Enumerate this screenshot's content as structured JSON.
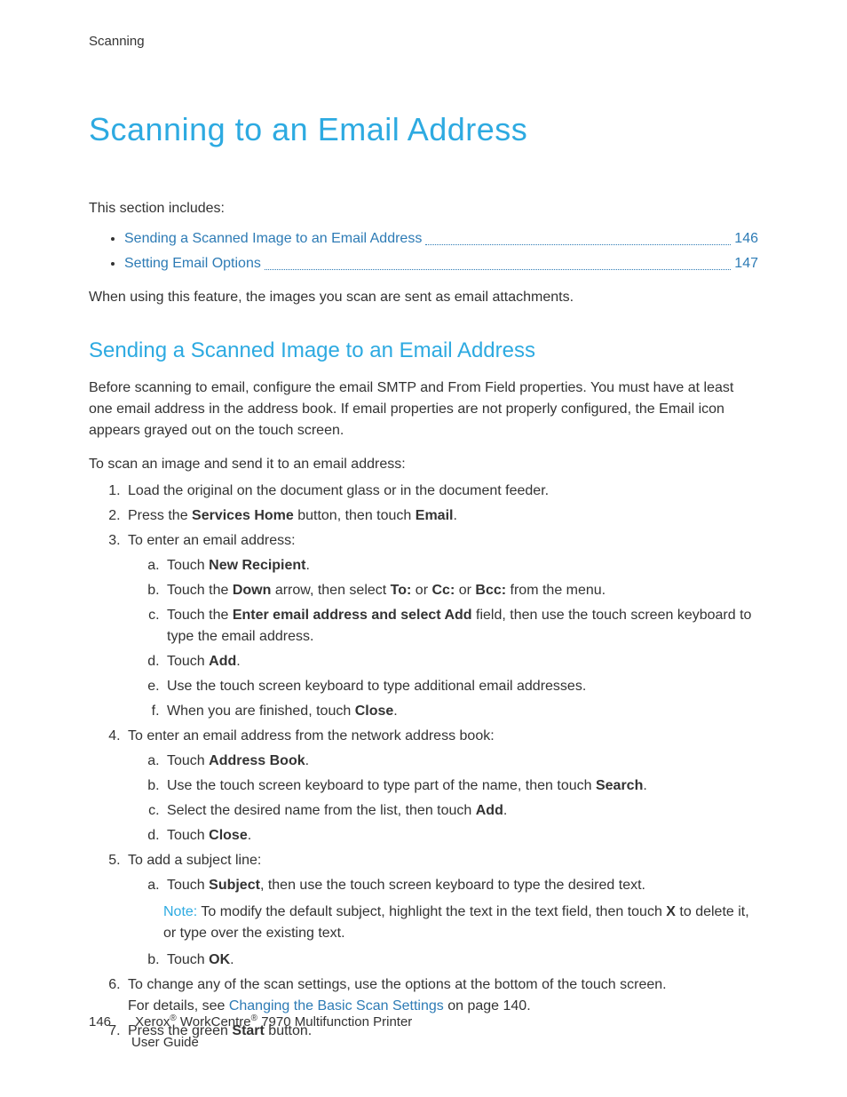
{
  "header": {
    "section_label": "Scanning"
  },
  "title": "Scanning to an Email Address",
  "includes_label": "This section includes:",
  "toc": [
    {
      "label": "Sending a Scanned Image to an Email Address",
      "page": "146"
    },
    {
      "label": "Setting Email Options",
      "page": "147"
    }
  ],
  "intro_para": "When using this feature, the images you scan are sent as email attachments.",
  "section": {
    "title": "Sending a Scanned Image to an Email Address",
    "para1": "Before scanning to email, configure the email SMTP and From Field properties. You must have at least one email address in the address book. If email properties are not properly configured, the Email icon appears grayed out on the touch screen.",
    "para2": "To scan an image and send it to an email address:"
  },
  "steps": {
    "s1": "Load the original on the document glass or in the document feeder.",
    "s2_pre": "Press the ",
    "s2_b1": "Services Home",
    "s2_mid": " button, then touch ",
    "s2_b2": "Email",
    "s2_post": ".",
    "s3": "To enter an email address:",
    "s3a_pre": "Touch ",
    "s3a_b": "New Recipient",
    "s3a_post": ".",
    "s3b_pre": "Touch the ",
    "s3b_b1": "Down",
    "s3b_mid1": " arrow, then select ",
    "s3b_b2": "To:",
    "s3b_mid2": " or ",
    "s3b_b3": "Cc:",
    "s3b_mid3": " or ",
    "s3b_b4": "Bcc:",
    "s3b_post": " from the menu.",
    "s3c_pre": "Touch the ",
    "s3c_b": "Enter email address and select Add",
    "s3c_post": " field, then use the touch screen keyboard to type the email address.",
    "s3d_pre": "Touch ",
    "s3d_b": "Add",
    "s3d_post": ".",
    "s3e": "Use the touch screen keyboard to type additional email addresses.",
    "s3f_pre": "When you are finished, touch ",
    "s3f_b": "Close",
    "s3f_post": ".",
    "s4": "To enter an email address from the network address book:",
    "s4a_pre": "Touch ",
    "s4a_b": "Address Book",
    "s4a_post": ".",
    "s4b_pre": "Use the touch screen keyboard to type part of the name, then touch ",
    "s4b_b": "Search",
    "s4b_post": ".",
    "s4c_pre": "Select the desired name from the list, then touch ",
    "s4c_b": "Add",
    "s4c_post": ".",
    "s4d_pre": "Touch ",
    "s4d_b": "Close",
    "s4d_post": ".",
    "s5": "To add a subject line:",
    "s5a_pre": "Touch ",
    "s5a_b": "Subject",
    "s5a_post": ", then use the touch screen keyboard to type the desired text.",
    "s5note_label": "Note:",
    "s5note_pre": " To modify the default subject, highlight the text in the text field, then touch ",
    "s5note_b": "X",
    "s5note_post": " to delete it, or type over the existing text.",
    "s5b_pre": "Touch ",
    "s5b_b": "OK",
    "s5b_post": ".",
    "s6_line1": "To change any of the scan settings, use the options at the bottom of the touch screen.",
    "s6_line2_pre": "For details, see ",
    "s6_link": "Changing the Basic Scan Settings",
    "s6_line2_post": " on page 140.",
    "s7_pre": "Press the green ",
    "s7_b": "Start",
    "s7_post": " button."
  },
  "footer": {
    "page_number": "146",
    "brand1": "Xerox",
    "brand2": " WorkCentre",
    "model": " 7970 Multifunction Printer",
    "line2": "User Guide"
  }
}
